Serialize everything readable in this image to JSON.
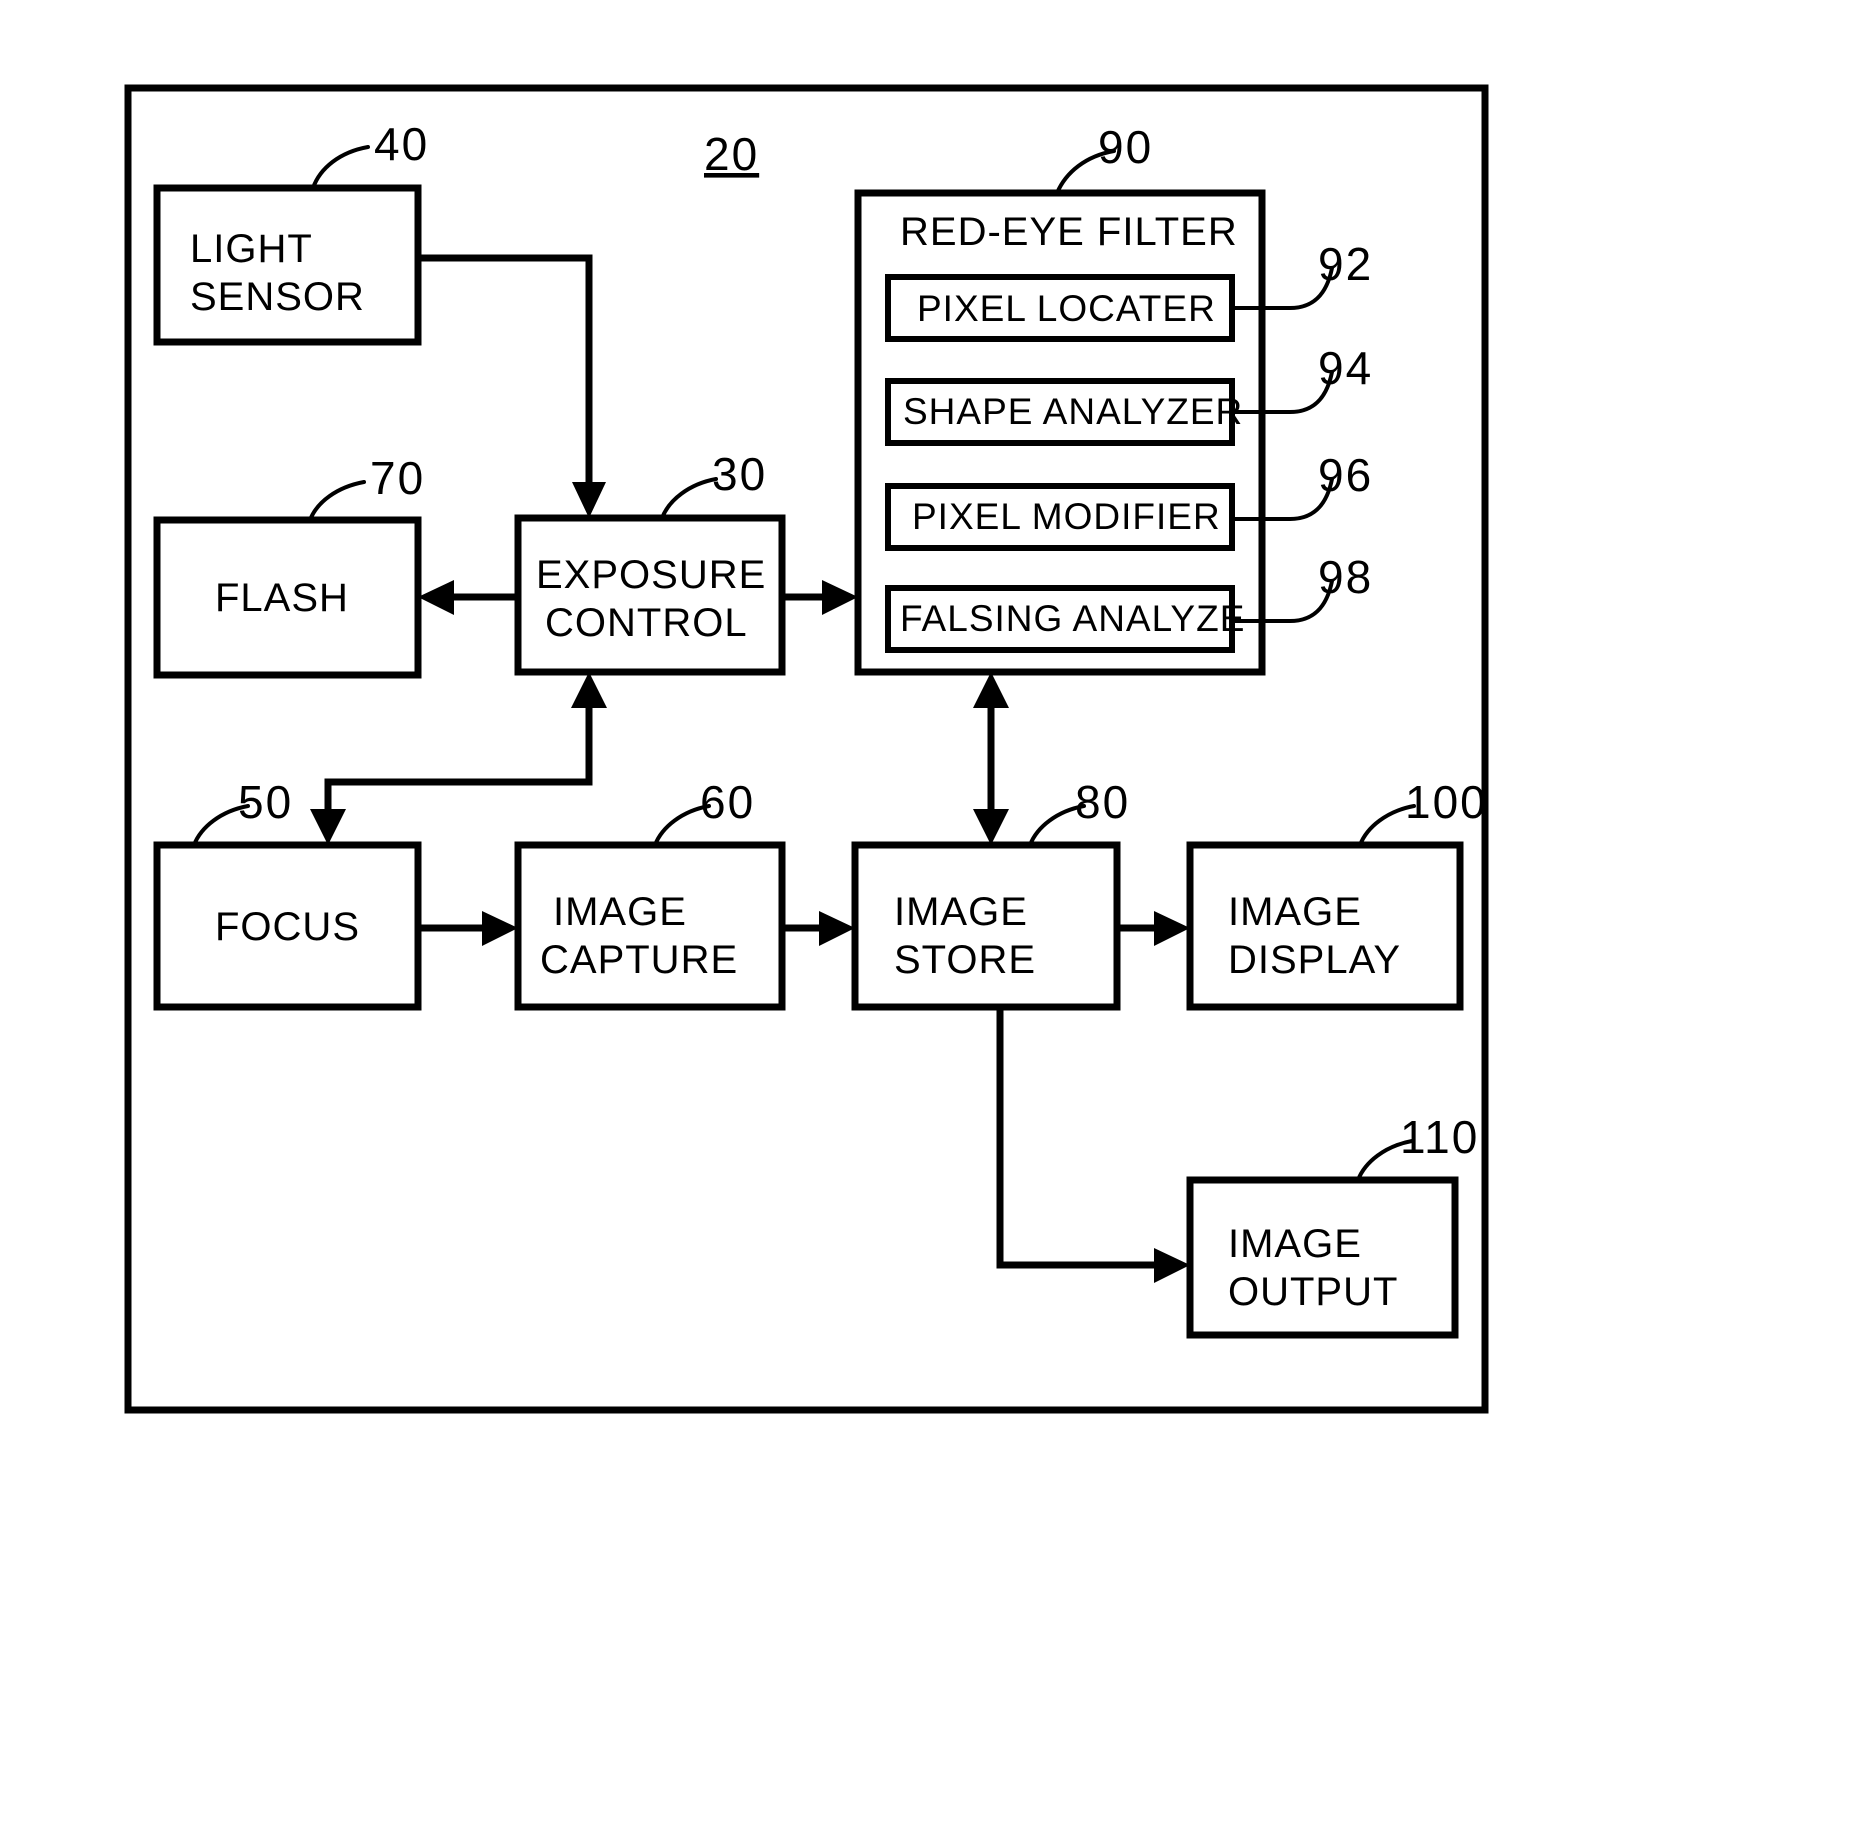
{
  "figure": {
    "ref_number": "20",
    "frame": {
      "label": "outer-frame"
    }
  },
  "blocks": [
    {
      "id": "light_sensor",
      "ref": "40",
      "lines": [
        "LIGHT",
        "SENSOR"
      ]
    },
    {
      "id": "flash",
      "ref": "70",
      "lines": [
        "FLASH"
      ]
    },
    {
      "id": "exposure_control",
      "ref": "30",
      "lines": [
        "EXPOSURE",
        "CONTROL"
      ]
    },
    {
      "id": "red_eye_filter",
      "ref": "90",
      "lines": [
        "RED-EYE FILTER"
      ]
    },
    {
      "id": "focus",
      "ref": "50",
      "lines": [
        "FOCUS"
      ]
    },
    {
      "id": "image_capture",
      "ref": "60",
      "lines": [
        "IMAGE",
        "CAPTURE"
      ]
    },
    {
      "id": "image_store",
      "ref": "80",
      "lines": [
        "IMAGE",
        "STORE"
      ]
    },
    {
      "id": "image_display",
      "ref": "100",
      "lines": [
        "IMAGE",
        "DISPLAY"
      ]
    },
    {
      "id": "image_output",
      "ref": "110",
      "lines": [
        "IMAGE",
        "OUTPUT"
      ]
    }
  ],
  "red_eye_filter": {
    "title": "RED-EYE FILTER",
    "ref": "90",
    "subblocks": [
      {
        "id": "pixel_locater",
        "label": "PIXEL LOCATER",
        "ref": "92"
      },
      {
        "id": "shape_analyzer",
        "label": "SHAPE ANALYZER",
        "ref": "94"
      },
      {
        "id": "pixel_modifier",
        "label": "PIXEL MODIFIER",
        "ref": "96"
      },
      {
        "id": "falsing_analyze",
        "label": "FALSING ANALYZE",
        "ref": "98"
      }
    ]
  },
  "labels": {
    "light_sensor_l1": "LIGHT",
    "light_sensor_l2": "SENSOR",
    "flash_l1": "FLASH",
    "exposure_l1": "EXPOSURE",
    "exposure_l2": "CONTROL",
    "redeye_title": "RED-EYE FILTER",
    "pixel_locater": "PIXEL LOCATER",
    "shape_analyzer": "SHAPE ANALYZER",
    "pixel_modifier": "PIXEL MODIFIER",
    "falsing_analyze": "FALSING ANALYZE",
    "focus_l1": "FOCUS",
    "capture_l1": "IMAGE",
    "capture_l2": "CAPTURE",
    "store_l1": "IMAGE",
    "store_l2": "STORE",
    "display_l1": "IMAGE",
    "display_l2": "DISPLAY",
    "output_l1": "IMAGE",
    "output_l2": "OUTPUT"
  },
  "refs": {
    "fig": "20",
    "light_sensor": "40",
    "exposure": "30",
    "flash": "70",
    "redeye": "90",
    "pixel_locater": "92",
    "shape_analyzer": "94",
    "pixel_modifier": "96",
    "falsing_analyze": "98",
    "focus": "50",
    "capture": "60",
    "store": "80",
    "display": "100",
    "output": "110"
  },
  "colors": {
    "ink": "#000000",
    "paper": "#ffffff"
  }
}
